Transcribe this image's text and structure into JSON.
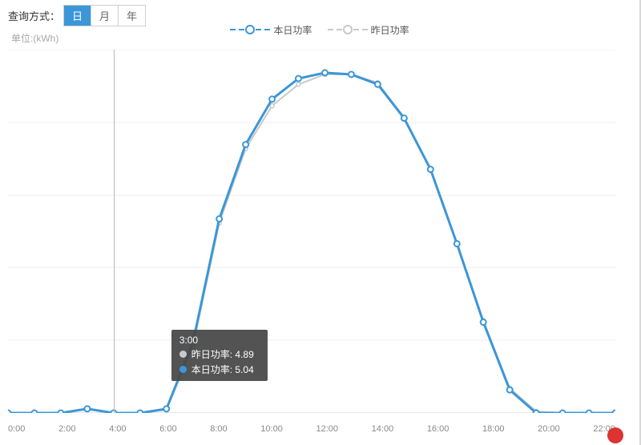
{
  "query_label": "查询方式：",
  "tabs": {
    "day": "日",
    "month": "月",
    "year": "年"
  },
  "unit": "单位:(kWh)",
  "legend": {
    "today": "本日功率",
    "yesterday": "昨日功率"
  },
  "colors": {
    "today": "#3b97d7",
    "yesterday": "#c9c9c9"
  },
  "tooltip": {
    "time": "3:00",
    "yesterday_label": "昨日功率: 4.89",
    "today_label": "本日功率: 5.04"
  },
  "chart_data": {
    "type": "line",
    "xlabel": "",
    "ylabel": "",
    "categories": [
      "0:00",
      "2:00",
      "4:00",
      "6:00",
      "8:00",
      "10:00",
      "12:00",
      "14:00",
      "16:00",
      "18:00",
      "20:00",
      "22:00"
    ],
    "x": [
      0,
      1,
      2,
      3,
      4,
      5,
      6,
      7,
      8,
      9,
      10,
      11,
      12,
      13,
      14,
      15,
      16,
      17,
      18,
      19,
      20,
      21,
      22,
      23
    ],
    "series": [
      {
        "name": "本日功率",
        "values": [
          0,
          0,
          0,
          5.04,
          0,
          0,
          5,
          85,
          235,
          325,
          380,
          405,
          412,
          410,
          398,
          357,
          295,
          205,
          110,
          28,
          0,
          0,
          0,
          0
        ]
      },
      {
        "name": "昨日功率",
        "values": [
          0,
          0,
          0,
          4.89,
          0,
          0,
          4,
          80,
          230,
          320,
          372,
          398,
          410,
          410,
          400,
          358,
          296,
          206,
          112,
          30,
          2,
          0,
          0,
          0
        ]
      }
    ],
    "ylim": [
      0,
      440
    ],
    "xlim": [
      0,
      23
    ]
  },
  "xticks": [
    "0:00",
    "2:00",
    "4:00",
    "6:00",
    "8:00",
    "10:00",
    "12:00",
    "14:00",
    "16:00",
    "18:00",
    "20:00",
    "22:00"
  ]
}
